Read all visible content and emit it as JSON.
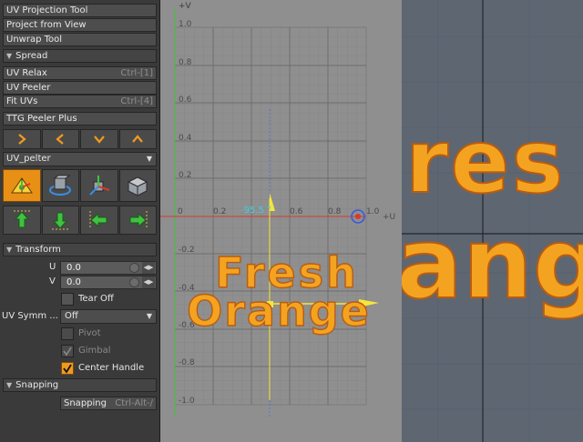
{
  "tools": {
    "uv_projection": "UV Projection Tool",
    "project_view": "Project from View",
    "unwrap": "Unwrap Tool",
    "spread_header": "Spread",
    "uv_relax": "UV Relax",
    "uv_relax_shortcut": "Ctrl-[1]",
    "uv_peeler": "UV Peeler",
    "fit_uvs": "Fit UVs",
    "fit_uvs_shortcut": "Ctrl-[4]",
    "ttg_peeler": "TTG Peeler Plus",
    "dropdown_value": "UV_pelter"
  },
  "transform": {
    "header": "Transform",
    "u_label": "U",
    "u_value": "0.0",
    "v_label": "V",
    "v_value": "0.0",
    "tear_off": "Tear Off",
    "uv_symm_label": "UV Symm ...",
    "uv_symm_value": "Off",
    "pivot": "Pivot",
    "gimbal": "Gimbal",
    "center_handle": "Center Handle"
  },
  "snapping": {
    "header": "Snapping",
    "button": "Snapping",
    "shortcut": "Ctrl-Alt-/"
  },
  "uv_view": {
    "v_axis": "+V",
    "u_axis": "+U",
    "y_ticks": [
      "1.0",
      "0.8",
      "0.6",
      "0.4",
      "0.2",
      "-0.2",
      "-0.4",
      "-0.6",
      "-0.8",
      "-1.0"
    ],
    "x_ticks": [
      "0",
      "0.2",
      "0.4",
      "0.6",
      "0.8",
      "1.0"
    ],
    "angle_readout": "-95.5 °",
    "text_line1": "Fresh",
    "text_line2": "Orange"
  },
  "viewport": {
    "text_line1": "res",
    "text_line2": "ang"
  },
  "colors": {
    "accent": "#f09a1e",
    "mesh": "#f4a321",
    "mesh_edge": "#b85c10",
    "axis_u": "#d83a2a",
    "axis_v": "#3cc43c",
    "handle": "#f6e63a"
  }
}
